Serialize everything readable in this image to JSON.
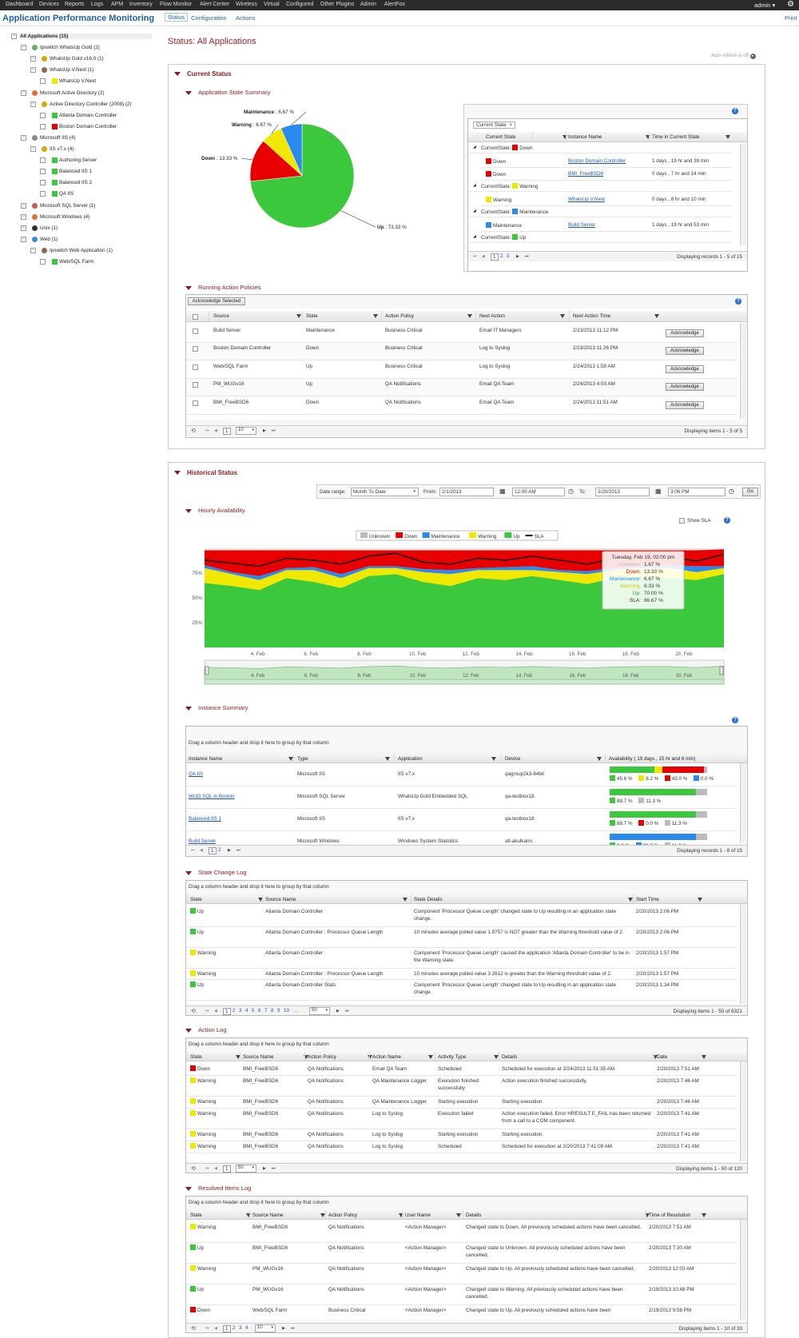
{
  "nav": {
    "items": [
      "Dashboard",
      "Devices",
      "Reports",
      "Logs",
      "APM",
      "Inventory",
      "Flow Monitor",
      "Alert Center",
      "Wireless",
      "Virtual",
      "Configured",
      "Other Plugins",
      "Admin",
      "AlertFox"
    ],
    "user": "admin"
  },
  "app": {
    "title": "Application Performance Monitoring",
    "tabs": [
      "Status",
      "Configuration",
      "Actions"
    ],
    "print": "Print"
  },
  "tree": [
    {
      "label": "All Applications (15)",
      "level": 0,
      "bold": true
    },
    {
      "label": "Ipswitch WhatsUp Gold (2)",
      "level": 1,
      "icon": "green-circle-icon"
    },
    {
      "label": "WhatsUp Gold v16.0 (1)",
      "level": 2,
      "icon": "warning-icon"
    },
    {
      "label": "WhatsUp V.Next (1)",
      "level": 2,
      "icon": "person-icon"
    },
    {
      "label": "WhatsUp V.Next",
      "level": 3,
      "icon": "yellow"
    },
    {
      "label": "Microsoft Active Directory (2)",
      "level": 1,
      "icon": "windows-icon"
    },
    {
      "label": "Active Directory Controller (2008) (2)",
      "level": 2,
      "icon": "warning-icon"
    },
    {
      "label": "Atlanta Domain Controller",
      "level": 3,
      "icon": "green"
    },
    {
      "label": "Boston Domain Controller",
      "level": 3,
      "icon": "red"
    },
    {
      "label": "Microsoft IIS (4)",
      "level": 1,
      "icon": "iis-icon"
    },
    {
      "label": "IIS v7.x (4)",
      "level": 2,
      "icon": "warning-icon"
    },
    {
      "label": "Authoring Server",
      "level": 3,
      "icon": "green"
    },
    {
      "label": "Balanced IIS 1",
      "level": 3,
      "icon": "green"
    },
    {
      "label": "Balanced IIS 2",
      "level": 3,
      "icon": "green"
    },
    {
      "label": "QA IIS",
      "level": 3,
      "icon": "green"
    },
    {
      "label": "Microsoft SQL Server (1)",
      "level": 1,
      "icon": "sql-icon"
    },
    {
      "label": "Microsoft Windows (4)",
      "level": 1,
      "icon": "windows-icon"
    },
    {
      "label": "Unix (1)",
      "level": 1,
      "icon": "unix-icon"
    },
    {
      "label": "Web (1)",
      "level": 1,
      "icon": "globe-icon"
    },
    {
      "label": "Ipswitch Web Application (1)",
      "level": 2,
      "icon": "person-icon"
    },
    {
      "label": "Web/SQL Farm",
      "level": 3,
      "icon": "green"
    }
  ],
  "status": {
    "title": "Status: All Applications",
    "auto_refresh": "Auto refresh is off",
    "current_status": "Current Status",
    "app_state_summary": "Application State Summary",
    "running_action_policies": "Running Action Policies",
    "historical_status": "Historical Status",
    "hourly_availability": "Hourly Availability",
    "instance_summary": "Instance Summary",
    "state_change_log": "State Change Log",
    "action_log": "Action Log",
    "resolved_items_log": "Resolved Items Log"
  },
  "colors": {
    "up": "#3cc83c",
    "down": "#e80000",
    "warning": "#f0e800",
    "maintenance": "#2a8af0",
    "unknown": "#bbbbbb",
    "accent": "#8b1a1a",
    "link": "#1a56b8"
  },
  "pie": {
    "slices": [
      {
        "label": "Up",
        "value": 73.33,
        "text": "Up : 73.33 %"
      },
      {
        "label": "Down",
        "value": 13.33,
        "text": "Down : 13.33 %"
      },
      {
        "label": "Warning",
        "value": 6.67,
        "text": "Warning : 6.67 %"
      },
      {
        "label": "Maintenance",
        "value": 6.67,
        "text": "Maintenance : 6.67 %"
      }
    ]
  },
  "state_grid": {
    "group_chip": "Current State",
    "headers": [
      "Current State",
      "Instance Name",
      "Time in Current State"
    ],
    "rows": [
      {
        "group": "CurrentState:",
        "group_state": "Down",
        "group_color": "down"
      },
      {
        "state": "Down",
        "color": "down",
        "name": "Boston Domain Controller",
        "time": "1 days , 19 hr and 39 min"
      },
      {
        "state": "Down",
        "color": "down",
        "name": "BMI_FreeBSD6",
        "time": "0 days , 7 hr and 14 min"
      },
      {
        "group": "CurrentState:",
        "group_state": "Warning",
        "group_color": "warning"
      },
      {
        "state": "Warning",
        "color": "warning",
        "name": "WhatsUp V.Next",
        "time": "0 days , 8 hr and 10 min"
      },
      {
        "group": "CurrentState:",
        "group_state": "Maintenance",
        "group_color": "maintenance"
      },
      {
        "state": "Maintenance",
        "color": "maintenance",
        "name": "Build Server",
        "time": "1 days , 19 hr and 53 min"
      },
      {
        "group": "CurrentState:",
        "group_state": "Up",
        "group_color": "up"
      }
    ],
    "pages": [
      "1",
      "2",
      "3"
    ],
    "footer": "Displaying records 1 - 5 of 15"
  },
  "policies": {
    "ack_selected": "Acknowledge Selected",
    "headers": [
      "Source",
      "State",
      "Action Policy",
      "Next Action",
      "Next Action Time"
    ],
    "rows": [
      {
        "source": "Build Server",
        "state": "Maintenance",
        "policy": "Business Critical",
        "next": "Email IT Managers",
        "time": "2/23/2013 11:12 PM",
        "btn": "Acknowledge"
      },
      {
        "source": "Boston Domain Controller",
        "state": "Down",
        "policy": "Business Critical",
        "next": "Log to Syslog",
        "time": "2/23/2013 11:26 PM",
        "btn": "Acknowledge"
      },
      {
        "source": "Web/SQL Farm",
        "state": "Up",
        "policy": "Business Critical",
        "next": "Log to Syslog",
        "time": "2/24/2013 1:58 AM",
        "btn": "Acknowledge"
      },
      {
        "source": "PM_WUGv16",
        "state": "Up",
        "policy": "QA Notifications",
        "next": "Email QA Team",
        "time": "2/24/2013 4:03 AM",
        "btn": "Acknowledge"
      },
      {
        "source": "BMI_FreeBSD6",
        "state": "Down",
        "policy": "QA Notifications",
        "next": "Email QA Team",
        "time": "2/24/2013 11:51 AM",
        "btn": "Acknowledge"
      }
    ],
    "page": "1",
    "page_size": "10",
    "footer": "Displaying items 1 - 5 of 5"
  },
  "date_range": {
    "label": "Date range:",
    "value": "Month To Date",
    "from_label": "From:",
    "from_date": "2/1/2013",
    "from_time": "12:00 AM",
    "to_label": "To:",
    "to_date": "2/20/2013",
    "to_time": "3:06 PM",
    "go": "Go"
  },
  "chart_data": {
    "type": "area",
    "title": "",
    "show_sla_label": "Show SLA",
    "legend": [
      "Unknown",
      "Down",
      "Maintenance",
      "Warning",
      "Up",
      "SLA"
    ],
    "yticks": [
      "25%",
      "50%",
      "75%"
    ],
    "xticks": [
      "4. Feb",
      "6. Feb",
      "8. Feb",
      "10. Feb",
      "12. Feb",
      "14. Feb",
      "16. Feb",
      "18. Feb",
      "20. Feb"
    ],
    "nav_ticks": [
      "4. Feb",
      "6. Feb",
      "8. Feb",
      "10. Feb",
      "12. Feb",
      "14. Feb",
      "16. Feb",
      "18. Feb",
      "20. Feb"
    ],
    "tooltip": {
      "title": "Tuesday, Feb 19, 02:00 pm",
      "rows": [
        {
          "label": "Unknown:",
          "value": "1.67 %",
          "color": "#bbbbbb"
        },
        {
          "label": "Down:",
          "value": "13.33 %",
          "color": "#e80000"
        },
        {
          "label": "Maintenance:",
          "value": "6.67 %",
          "color": "#2a8af0"
        },
        {
          "label": "Warning:",
          "value": "8.33 %",
          "color": "#d8c800"
        },
        {
          "label": "Up:",
          "value": "70.00 %",
          "color": "#2a9a2a"
        },
        {
          "label": "SLA:",
          "value": "86.67 %",
          "color": "#222222"
        }
      ]
    },
    "series": [
      {
        "name": "Up",
        "values": [
          65,
          62,
          58,
          70,
          66,
          60,
          72,
          74,
          66,
          62,
          70,
          68,
          72,
          68,
          64,
          70,
          72,
          70,
          68,
          74
        ]
      },
      {
        "name": "Warning",
        "values": [
          15,
          12,
          10,
          8,
          12,
          10,
          8,
          6,
          10,
          12,
          8,
          10,
          6,
          8,
          10,
          8,
          8,
          10,
          8,
          6
        ]
      },
      {
        "name": "Maintenance",
        "values": [
          3,
          2,
          4,
          2,
          3,
          4,
          2,
          2,
          3,
          4,
          2,
          3,
          4,
          2,
          3,
          2,
          2,
          3,
          6,
          2
        ]
      },
      {
        "name": "Down",
        "values": [
          15,
          22,
          26,
          18,
          17,
          24,
          16,
          16,
          19,
          20,
          18,
          17,
          16,
          20,
          21,
          18,
          16,
          15,
          16,
          17
        ]
      },
      {
        "name": "SLA",
        "values": [
          88,
          85,
          82,
          90,
          88,
          84,
          92,
          95,
          86,
          84,
          90,
          88,
          92,
          88,
          84,
          90,
          92,
          92,
          87,
          94
        ]
      }
    ],
    "ylim": [
      0,
      100
    ]
  },
  "instances": {
    "drag_hint": "Drag a column header and drop it here to group by that column",
    "headers": [
      "Instance Name",
      "Type",
      "Application",
      "Device",
      "Availability ( 19 days , 15 hr and 6 min)"
    ],
    "rows": [
      {
        "name": "QA IIS",
        "type": "Microsoft IIS",
        "app": "IIS v7.x",
        "device": "qagroup2k3-64bit",
        "bars": [
          {
            "c": "up",
            "v": 45.6
          },
          {
            "c": "warning",
            "v": 8.2
          },
          {
            "c": "down",
            "v": 43.0
          },
          {
            "c": "maintenance",
            "v": 0.0
          },
          {
            "c": "unknown",
            "v": 3.2
          }
        ],
        "legend": [
          {
            "c": "up",
            "t": "45.6 %"
          },
          {
            "c": "warning",
            "t": "8.2 %"
          },
          {
            "c": "down",
            "t": "43.0 %"
          },
          {
            "c": "maintenance",
            "t": "0.0 %"
          }
        ]
      },
      {
        "name": "WUG SQL in Boston",
        "type": "Microsoft SQL Server",
        "app": "WhatsUp Gold Embedded SQL",
        "device": "qa-testbox18.",
        "bars": [
          {
            "c": "up",
            "v": 88.7
          },
          {
            "c": "unknown",
            "v": 11.3
          }
        ],
        "legend": [
          {
            "c": "up",
            "t": "88.7 %"
          },
          {
            "c": "unknown",
            "t": "11.3 %"
          }
        ]
      },
      {
        "name": "Balanced IIS 1",
        "type": "Microsoft IIS",
        "app": "IIS v7.x",
        "device": "qa-testbox18.",
        "bars": [
          {
            "c": "up",
            "v": 88.7
          },
          {
            "c": "unknown",
            "v": 11.3
          }
        ],
        "legend": [
          {
            "c": "up",
            "t": "88.7 %"
          },
          {
            "c": "down",
            "t": "0.0 %"
          },
          {
            "c": "unknown",
            "t": "11.3 %"
          }
        ]
      },
      {
        "name": "Build Server",
        "type": "Microsoft Windows",
        "app": "Windows System Statistics",
        "device": "atl-akulkarni.",
        "bars": [
          {
            "c": "maintenance",
            "v": 88.7
          },
          {
            "c": "unknown",
            "v": 11.3
          }
        ],
        "legend": [
          {
            "c": "up",
            "t": "0.0 %"
          },
          {
            "c": "maintenance",
            "t": "88.7 %"
          },
          {
            "c": "unknown",
            "t": "11.3 %"
          }
        ]
      }
    ],
    "pages": [
      "1",
      "2"
    ],
    "footer": "Displaying records 1 - 8 of 15"
  },
  "state_log": {
    "drag_hint": "Drag a column header and drop it here to group by that column",
    "headers": [
      "State",
      "Source Name",
      "State Details",
      "Start Time"
    ],
    "rows": [
      {
        "state": "Up",
        "color": "up",
        "source": "Atlanta Domain Controller",
        "details": "Component 'Processor Queue Length' changed state to Up resulting in an application state change.",
        "time": "2/20/2013 2:06 PM"
      },
      {
        "state": "Up",
        "color": "up",
        "source": "Atlanta Domain Controller : Processor Queue Length",
        "details": "10 minutes average polled value 1.9757 is NOT greater than the Warning threshold value of 2.",
        "time": "2/20/2013 2:06 PM"
      },
      {
        "state": "Warning",
        "color": "warning",
        "source": "Atlanta Domain Controller",
        "details": "Component 'Processor Queue Length' caused the application 'Atlanta Domain Controller' to be in the Warning state.",
        "time": "2/20/2013 1:57 PM"
      },
      {
        "state": "Warning",
        "color": "warning",
        "source": "Atlanta Domain Controller : Processor Queue Length",
        "details": "10 minutes average polled value 3.2612 is greater than the Warning threshold value of 2.",
        "time": "2/20/2013 1:57 PM"
      },
      {
        "state": "Up",
        "color": "up",
        "source": "Atlanta Domain Controller Stats",
        "details": "Component 'Processor Queue Length' changed state to Up resulting in an application state change.",
        "time": "2/20/2013 1:34 PM"
      }
    ],
    "pages": [
      "1",
      "2",
      "3",
      "4",
      "5",
      "6",
      "7",
      "8",
      "9",
      "10",
      "..."
    ],
    "page_size": "50",
    "footer": "Displaying items 1 - 50 of 6321"
  },
  "action_log": {
    "drag_hint": "Drag a column header and drop it here to group by that column",
    "headers": [
      "State",
      "Source Name",
      "Action Policy",
      "Action Name",
      "Activity Type",
      "Details",
      "Date"
    ],
    "rows": [
      {
        "state": "Down",
        "color": "down",
        "source": "BMI_FreeBSD6",
        "policy": "QA Notifications",
        "action": "Email QA Team",
        "type": "Scheduled",
        "details": "Scheduled for execution at 2/24/2013 11:51:35 AM.",
        "date": "2/20/2013 7:51 AM"
      },
      {
        "state": "Warning",
        "color": "warning",
        "source": "BMI_FreeBSD6",
        "policy": "QA Notifications",
        "action": "QA Maintenance Logger",
        "type": "Execution finished successfully",
        "details": "Action execution finished successfully.",
        "date": "2/20/2013 7:46 AM"
      },
      {
        "state": "Warning",
        "color": "warning",
        "source": "BMI_FreeBSD6",
        "policy": "QA Notifications",
        "action": "QA Maintenance Logger",
        "type": "Starting execution",
        "details": "Starting execution.",
        "date": "2/20/2013 7:46 AM"
      },
      {
        "state": "Warning",
        "color": "warning",
        "source": "BMI_FreeBSD6",
        "policy": "QA Notifications",
        "action": "Log to Syslog",
        "type": "Execution failed",
        "details": "Action execution failed. Error HRESULT E_FAIL has been returned from a call to a COM component.",
        "date": "2/20/2013 7:41 AM"
      },
      {
        "state": "Warning",
        "color": "warning",
        "source": "BMI_FreeBSD6",
        "policy": "QA Notifications",
        "action": "Log to Syslog",
        "type": "Starting execution",
        "details": "Starting execution.",
        "date": "2/20/2013 7:41 AM"
      },
      {
        "state": "Warning",
        "color": "warning",
        "source": "BMI_FreeBSD6",
        "policy": "QA Notifications",
        "action": "Log to Syslog",
        "type": "Scheduled",
        "details": "Scheduled for execution at 2/20/2013 7:41:09 AM.",
        "date": "2/20/2013 7:41 AM"
      }
    ],
    "page": "1",
    "page_size": "50",
    "footer": "Displaying items 1 - 50 of 120"
  },
  "resolved": {
    "drag_hint": "Drag a column header and drop it here to group by that column",
    "headers": [
      "State",
      "Source Name",
      "Action Policy",
      "User Name",
      "Details",
      "Time of Resolution"
    ],
    "rows": [
      {
        "state": "Warning",
        "color": "warning",
        "source": "BMI_FreeBSD6",
        "policy": "QA Notifications",
        "user": "<Action Manager>",
        "details": "Changed state to Down. All previously scheduled actions have been cancelled.",
        "time": "2/20/2013 7:51 AM"
      },
      {
        "state": "Up",
        "color": "up",
        "source": "BMI_FreeBSD6",
        "policy": "QA Notifications",
        "user": "<Action Manager>",
        "details": "Changed state to Unknown. All previously scheduled actions have been cancelled.",
        "time": "2/20/2013 7:30 AM"
      },
      {
        "state": "Warning",
        "color": "warning",
        "source": "PM_WUGv16",
        "policy": "QA Notifications",
        "user": "<Action Manager>",
        "details": "Changed state to Up. All previously scheduled actions have been cancelled.",
        "time": "2/20/2013 12:03 AM"
      },
      {
        "state": "Up",
        "color": "up",
        "source": "PM_WUGv16",
        "policy": "QA Notifications",
        "user": "<Action Manager>",
        "details": "Changed state to Warning. All previously scheduled actions have been cancelled.",
        "time": "2/19/2013 10:48 PM"
      },
      {
        "state": "Down",
        "color": "down",
        "source": "Web/SQL Farm",
        "policy": "Business Critical",
        "user": "<Action Manager>",
        "details": "Changed state to Up. All previously scheduled actions have been",
        "time": "2/19/2013 9:58 PM"
      }
    ],
    "pages": [
      "1",
      "2",
      "3",
      "4"
    ],
    "page_size": "10",
    "footer": "Displaying items 1 - 10 of 33"
  }
}
